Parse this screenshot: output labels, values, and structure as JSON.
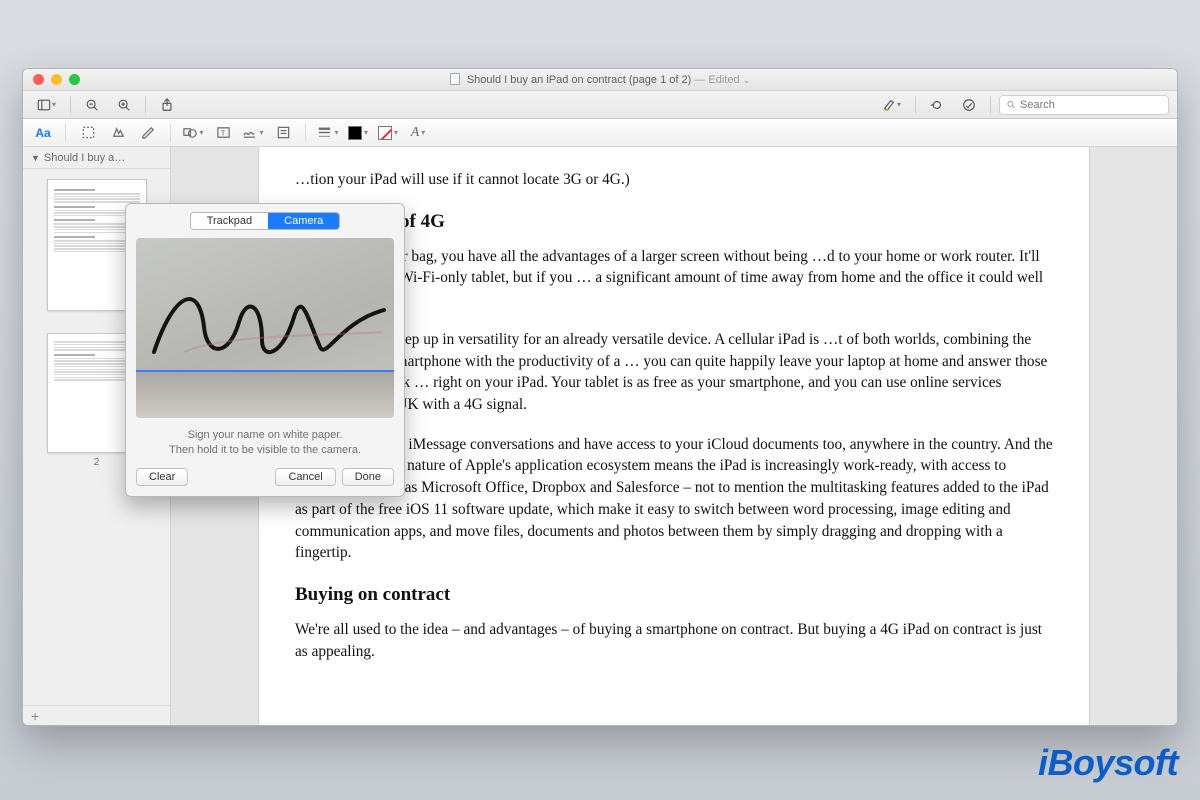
{
  "title": {
    "filename": "Should I buy an iPad on contract (page 1 of 2)",
    "status": "Edited"
  },
  "search": {
    "placeholder": "Search"
  },
  "sidebar": {
    "header_label": "Should I buy a…",
    "pages": [
      "",
      "2"
    ]
  },
  "signature": {
    "tabs": {
      "trackpad": "Trackpad",
      "camera": "Camera"
    },
    "instruction_line1": "Sign your name on white paper.",
    "instruction_line2": "Then hold it to be visible to the camera.",
    "buttons": {
      "clear": "Clear",
      "cancel": "Cancel",
      "done": "Done"
    }
  },
  "markup": {
    "aa_label": "Aa"
  },
  "document": {
    "p0": "…tion your iPad will use if it cannot locate 3G or 4G.)",
    "h1": "…dvantages of 4G",
    "p1": "…4G iPad in your bag, you have all the advantages of a larger screen without being …d to your home or work router. It'll cost more than a Wi-Fi-only tablet, but if you … a significant amount of time away from home and the office it could well be worth it.",
    "p2": "…e 4G is a real step up in versatility for an already versatile device. A cellular iPad is …t of both worlds, combining the portability of a smartphone with the productivity of a … you can quite happily leave your laptop at home and answer those all-important work … right on your iPad. Your tablet is as free as your smartphone, and you can use online services anywhere in the UK with a 4G signal.",
    "p3": "You'll get all your iMessage conversations and have access to your iCloud documents too, anywhere in the country. And the increasingly open nature of Apple's application ecosystem means the iPad is increasingly work-ready, with access to applications such as Microsoft Office, Dropbox and Salesforce – not to mention the multitasking features added to the iPad as part of the free iOS 11 software update, which make it easy to switch between word processing, image editing and communication apps, and move files, documents and photos between them by simply dragging and dropping with a fingertip.",
    "h2": "Buying on contract",
    "p4": "We're all used to the idea – and advantages – of buying a smartphone on contract. But buying a 4G iPad on contract is just as appealing."
  },
  "watermark": "iBoysoft"
}
